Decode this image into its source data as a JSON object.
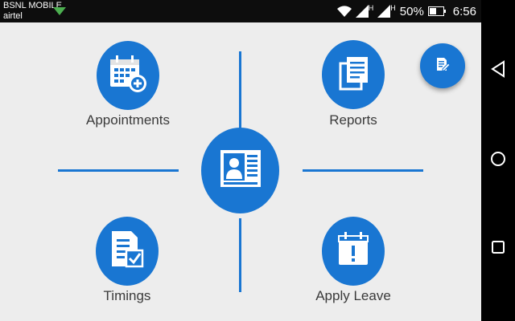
{
  "status_bar": {
    "carrier_primary": "BSNL MOBILE",
    "carrier_secondary": "airtel",
    "signal_type_1": "H",
    "signal_type_2": "H",
    "battery": "50%",
    "time": "6:56"
  },
  "menu": {
    "appointments_label": "Appointments",
    "reports_label": "Reports",
    "timings_label": "Timings",
    "apply_leave_label": "Apply Leave"
  },
  "colors": {
    "accent": "#1976d2",
    "background": "#ededed"
  }
}
